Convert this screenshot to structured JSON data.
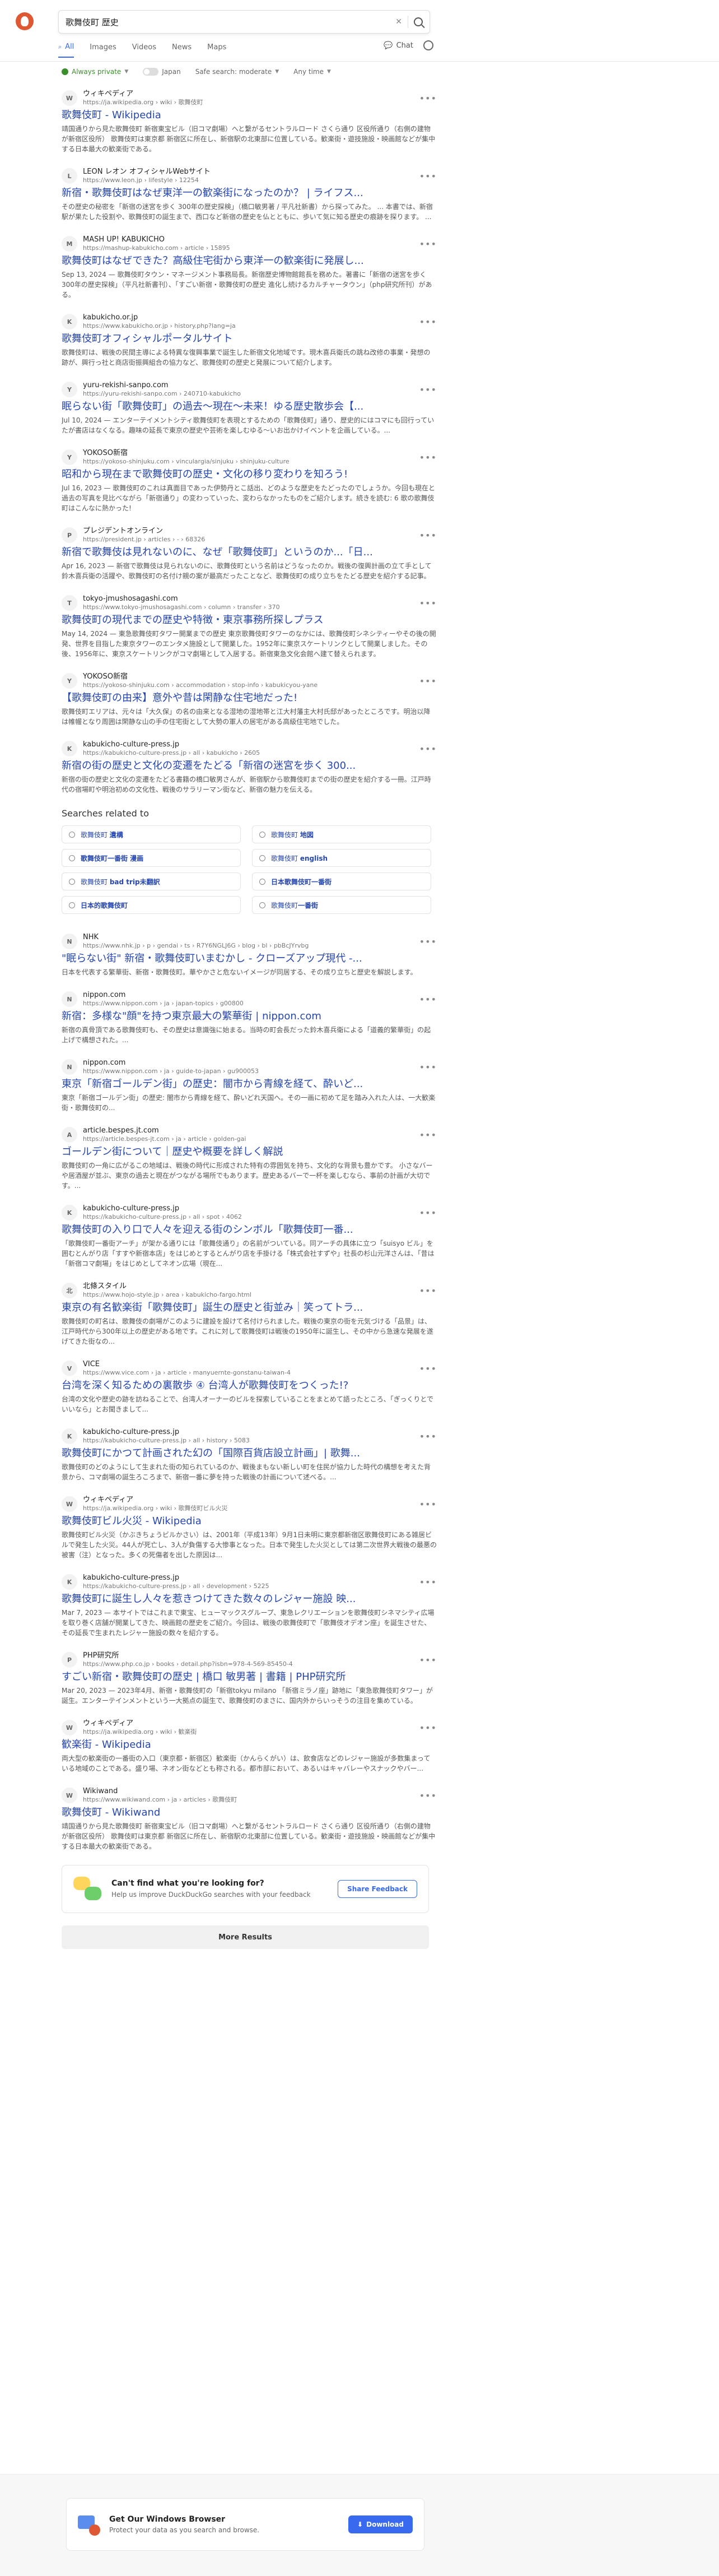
{
  "search": {
    "query": "歌舞伎町 歴史"
  },
  "tabs": [
    {
      "label": "All",
      "active": true
    },
    {
      "label": "Images"
    },
    {
      "label": "Videos"
    },
    {
      "label": "News"
    },
    {
      "label": "Maps"
    }
  ],
  "chat_label": "Chat",
  "filters": {
    "always_private": "Always private",
    "region": "Japan",
    "safe_search": "Safe search: moderate",
    "time": "Any time"
  },
  "results_a": [
    {
      "fav": "W",
      "site": "ウィキペディア",
      "url": "https://ja.wikipedia.org › wiki › 歌舞伎町",
      "title": "歌舞伎町 - Wikipedia",
      "snippet": "靖国通りから見た歌舞伎町 新宿東宝ビル（旧コマ劇場）へと繋がるセントラルロード さくら通り 区役所通り（右側の建物が新宿区役所） 歌舞伎町は東京都 新宿区に所在し、新宿駅の北東部に位置している。歓楽街・遊技施設・映画館などが集中する日本最大の歓楽街である。"
    },
    {
      "fav": "L",
      "site": "LEON レオン オフィシャルWebサイト",
      "url": "https://www.leon.jp › lifestyle › 12254",
      "title": "新宿・歌舞伎町はなぜ東洋一の歓楽街になったのか？ | ライフス...",
      "snippet": "その歴史の秘密を「新宿の迷宮を歩く 300年の歴史探検」（橋口敏男著 / 平凡社新書）から探ってみた。 ... 本書では、新宿駅が果たした役割や、歌舞伎町の誕生まで、西口など新宿の歴史を仏とともに、歩いて気に知る歴史の痕跡を探ります。 ..."
    },
    {
      "fav": "M",
      "site": "MASH UP! KABUKICHO",
      "url": "https://mashup-kabukicho.com › article › 15895",
      "title": "歌舞伎町はなぜできた？高級住宅街から東洋一の歓楽街に発展し...",
      "snippet": "Sep 13, 2024 — 歌舞伎町タウン・マネージメント事務局長。新宿歴史博物館館長を務めた。著書に「新宿の迷宮を歩く 300年の歴史探検」（平凡社新書刊）、「すごい新宿・歌舞伎町の歴史 進化し続けるカルチャータウン」（php研究所刊）がある。"
    },
    {
      "fav": "K",
      "site": "kabukicho.or.jp",
      "url": "https://www.kabukicho.or.jp › history.php?lang=ja",
      "title": "歌舞伎町オフィシャルポータルサイト",
      "snippet": "歌舞伎町は、戦後の民間主導による特異な復興事業で誕生した新宿文化地域です。現木喜兵衛氏の跳ね改修の事業・発想の跡が、興行っ社と商店街振興組合の協力など、歌舞伎町の歴史と発展について紹介します。"
    },
    {
      "fav": "Y",
      "site": "yuru-rekishi-sanpo.com",
      "url": "https://yuru-rekishi-sanpo.com › 240710-kabukicho",
      "title": "眠らない街「歌舞伎町」の過去〜現在〜未来！ゆる歴史散歩会【...",
      "snippet": "Jul 10, 2024 — エンターテイメントシティ歌舞伎町を表現とするための「歌舞伎町」通り、歴史的にはコマにも回行っていたが書店はなくなる。趣味の延長で東京の歴史や芸術を楽しむゆる〜いお出かけイベントを企画している。..."
    },
    {
      "fav": "Y",
      "site": "YOKOSO新宿",
      "url": "https://yokoso-shinjuku.com › vinculargia/sinjuku › shinjuku-culture",
      "title": "昭和から現在まで歌舞伎町の歴史・文化の移り変わりを知ろう!",
      "snippet": "Jul 16, 2023 — 歌舞伎町のこれは真面目であった伊勢丹とこ話出、どのような歴史をたどったのでしょうか。今回も現在と過去の写真を見比べながら「新宿通り」の変わっていった、変わらなかったものをご紹介します。続きを読む: 6 歌の歌舞伎町はこんなに熱かった!"
    },
    {
      "fav": "P",
      "site": "プレジデントオンライン",
      "url": "https://president.jp › articles › - › 68326",
      "title": "新宿で歌舞伎は見れないのに、なぜ「歌舞伎町」というのか...「日...",
      "snippet": "Apr 16, 2023 — 新宿で歌舞伎は見られないのに、歌舞伎町という名前はどうなったのか。戦後の復興計画の立て手として鈴木喜兵衛の活躍や、歌舞伎町の名付け親の案が最高だったことなど、歌舞伎町の成り立ちをたどる歴史を紹介する記事。"
    },
    {
      "fav": "T",
      "site": "tokyo-jmushosagashi.com",
      "url": "https://www.tokyo-jmushosagashi.com › column › transfer › 370",
      "title": "歌舞伎町の現代までの歴史や特徴・東京事務所探しプラス",
      "snippet": "May 14, 2024 — 東急歌舞伎町タワー開業までの歴史 東京歌舞伎町タワーのなかには、歌舞伎町シネシティーやその後の開発、世界を目指した東京タワーのエンタメ施設として開業した。1952年に東京スケートリンクとして開業しました。その後、1956年に、東京スケートリンクがコマ劇場として入居する。新宿東急文化会館へ建て替えられます。"
    },
    {
      "fav": "Y",
      "site": "YOKOSO新宿",
      "url": "https://yokoso-shinjuku.com › accommodation › stop-info › kabukicyou-yane",
      "title": "【歌舞伎町の由来】意外や昔は閑静な住宅地だった!",
      "snippet": "歌舞伎町エリアは、元々は「大久保」の名の由来となる湿地の湿地帯と江大村藩主大村氏邸があったところです。明治以降は帷幄となり周囲は閑静な山の手の住宅街として大勢の軍人の居宅がある高級住宅地でした。"
    },
    {
      "fav": "K",
      "site": "kabukicho-culture-press.jp",
      "url": "https://kabukicho-culture-press.jp › all › kabukicho › 2605",
      "title": "新宿の街の歴史と文化の変遷をたどる「新宿の迷宮を歩く 300...",
      "snippet": "新宿の街の歴史と文化の変遷をたどる書籍の橋口敏男さんが、新宿駅から歌舞伎町までの街の歴史を紹介する一冊。江戸時代の宿場町や明治初めの文化性、戦後のサラリーマン街など、新宿の魅力を伝える。"
    }
  ],
  "related": {
    "heading": "Searches related to",
    "items": [
      {
        "pre": "歌舞伎町 ",
        "bold": "遺構"
      },
      {
        "pre": "歌舞伎町 ",
        "bold": "地図"
      },
      {
        "pre": "",
        "bold": "歌舞伎町一番街 漫画"
      },
      {
        "pre": "歌舞伎町 ",
        "bold": "english"
      },
      {
        "pre": "歌舞伎町 ",
        "bold": "bad trip未翻訳"
      },
      {
        "pre": "",
        "bold": "日本歌舞伎町一番街"
      },
      {
        "pre": "",
        "bold": "日本的歌舞伎町"
      },
      {
        "pre": "歌舞伎町",
        "bold": "一番街"
      }
    ]
  },
  "results_b": [
    {
      "fav": "N",
      "site": "NHK",
      "url": "https://www.nhk.jp › p › gendai › ts › R7Y6NGLJ6G › blog › bl › pbBcJYrvbg",
      "title": "\"眠らない街\" 新宿・歌舞伎町いまむかし - クローズアップ現代 -...",
      "snippet": "日本を代表する繁華街、新宿・歌舞伎町。華やかさと危ないイメージが同居する、その成り立ちと歴史を解説します。"
    },
    {
      "fav": "N",
      "site": "nippon.com",
      "url": "https://www.nippon.com › ja › japan-topics › g00800",
      "title": "新宿：多様な\"顔\"を持つ東京最大の繁華街 | nippon.com",
      "snippet": "新宿の真骨頂である歌舞伎町も、その歴史は意識強に始まる。当時の町会長だった鈴木喜兵衛による「道義的繁華街」の起上げで構想された。..."
    },
    {
      "fav": "N",
      "site": "nippon.com",
      "url": "https://www.nippon.com › ja › guide-to-japan › gu900053",
      "title": "東京「新宿ゴールデン街」の歴史：闇市から青線を経て、酔いど...",
      "snippet": "東京「新宿ゴールデン街」の歴史: 闇市から青線を経て、酔いどれ天国へ。その一画に初めて足を踏み入れた人は、一大歓楽街・歌舞伎町の..."
    },
    {
      "fav": "A",
      "site": "article.bespes.jt.com",
      "url": "https://article.bespes-jt.com › ja › article › golden-gai",
      "title": "ゴールデン街について｜歴史や概要を詳しく解説",
      "snippet": "歌舞伎町の一角に広がるこの地域は、戦後の時代に形成された特有の雰囲気を持ち、文化的な背景も豊かです。 小さなバーや居酒屋が並ぶ、東京の過去と現在がつながる場所でもあります。歴史あるバーで一杯を楽しむなら、事前の計画が大切です。..."
    },
    {
      "fav": "K",
      "site": "kabukicho-culture-press.jp",
      "url": "https://kabukicho-culture-press.jp › all › spot › 4062",
      "title": "歌舞伎町の入り口で人々を迎える街のシンボル「歌舞伎町一番...",
      "snippet": "「歌舞伎町一番街アーチ」が架かる通りには「歌舞伎通り」の名前がついている。同アーチの具体に立つ「suisyo ビル」を囲むとんがり店「すすや新宿本店」をはじめとするとんがり店を手掛ける「株式会社すずや」社長の杉山元洋さんは、「昔は「新宿コマ劇場」をはじめとしてネオン広場（現在..."
    },
    {
      "fav": "北",
      "site": "北條スタイル",
      "url": "https://www.hojo-style.jp › area › kabukicho-fargo.html",
      "title": "東京の有名歓楽街「歌舞伎町」誕生の歴史と街並み｜笑ってトラ...",
      "snippet": "歌舞伎町の町名は、歌舞伎の劇場がこのように建設を設けて名付けられました。戦後の東京の街を元気づける「品景」は、江戸時代から300年以上の歴史がある地です。これに対して歌舞伎町は戦後の1950年に誕生し、その中から急速な発展を遂げてきた街なの..."
    },
    {
      "fav": "V",
      "site": "VICE",
      "url": "https://www.vice.com › ja › article › manyuernte-gonstanu-taiwan-4",
      "title": "台湾を深く知るための裏散歩 ④ 台湾人が歌舞伎町をつくった!?",
      "snippet": "台湾の文化や歴史の跡を訪ねることで、台湾人オーナーのビルを探索していることをまとめて語ったところ、「ぎっくりとでいいなら」とお聞きまして..."
    },
    {
      "fav": "K",
      "site": "kabukicho-culture-press.jp",
      "url": "https://kabukicho-culture-press.jp › all › history › 5083",
      "title": "歌舞伎町にかつて計画された幻の「国際百貨店設立計画」| 歌舞...",
      "snippet": "歌舞伎町のどのようにして生まれた街の知られているのか、戦後まもない新しい町を住民が協力した時代の構想を考えた背景から、コマ劇場の誕生ろころまで、新宿一番に夢を持った戦後の計画について述べる。..."
    },
    {
      "fav": "W",
      "site": "ウィキペディア",
      "url": "https://ja.wikipedia.org › wiki › 歌舞伎町ビル火災",
      "title": "歌舞伎町ビル火災 - Wikipedia",
      "snippet": "歌舞伎町ビル火災（かぶきちょうビルかさい）は、2001年（平成13年）9月1日未明に東京都新宿区歌舞伎町にある雑居ビルで発生した火災。44人が死亡し、3人が負傷する大惨事となった。日本で発生した火災としては第二次世界大戦後の最悪の被害（注）となった。多くの死傷者を出した原因は..."
    },
    {
      "fav": "K",
      "site": "kabukicho-culture-press.jp",
      "url": "https://kabukicho-culture-press.jp › all › development › 5225",
      "title": "歌舞伎町に誕生し人々を惹きつけてきた数々のレジャー施設 映...",
      "snippet": "Mar 7, 2023 — 本サイトではこれまで東宝、ヒューマックスグループ、東急レクリエーションを歌舞伎町シネマシティ広場を取り巻く店舗が開業してきた、映画館の歴史をご紹介。今回は、戦後の歌舞伎町で「歌舞伎オデオン座」を誕生させた、その延長で生まれたレジャー施設の数々を紹介する。"
    },
    {
      "fav": "P",
      "site": "PHP研究所",
      "url": "https://www.php.co.jp › books › detail.php?isbn=978-4-569-85450-4",
      "title": "すごい新宿・歌舞伎町の歴史 | 橋口 敏男著 | 書籍 | PHP研究所",
      "snippet": "Mar 20, 2023 — 2023年4月、新宿・歌舞伎町の「新宿tokyu milano 「新宿ミラノ座」跡地に「東急歌舞伎町タワー」が誕生。エンターテインメントという一大拠点の誕生で、歌舞伎町のまさに、国内外からいっそうの注目を集めている。"
    },
    {
      "fav": "W",
      "site": "ウィキペディア",
      "url": "https://ja.wikipedia.org › wiki › 歓楽街",
      "title": "歓楽街 - Wikipedia",
      "snippet": "両大型の歓楽街の一番街の入口（東京都・新宿区）歓楽街（かんらくがい）は、飲食店などのレジャー施設が多数集まっている地域のことである。盛り場、ネオン街などとも称される。都市部において、あるいはキャバレーやスナックやバー..."
    },
    {
      "fav": "W",
      "site": "Wikiwand",
      "url": "https://www.wikiwand.com › ja › articles › 歌舞伎町",
      "title": "歌舞伎町 - Wikiwand",
      "snippet": "靖国通りから見た歌舞伎町 新宿東宝ビル（旧コマ劇場）へと繋がるセントラルロード さくら通り 区役所通り（右側の建物が新宿区役所） 歌舞伎町は東京都 新宿区に所在し、新宿駅の北東部に位置している。歓楽街・遊技施設・映画館などが集中する日本最大の歓楽街である。"
    }
  ],
  "feedback": {
    "title": "Can't find what you're looking for?",
    "sub": "Help us improve DuckDuckGo searches with your feedback",
    "button": "Share Feedback"
  },
  "more_results": "More Results",
  "promo": {
    "title": "Get Our Windows Browser",
    "sub": "Protect your data as you search and browse.",
    "button": "Download"
  }
}
